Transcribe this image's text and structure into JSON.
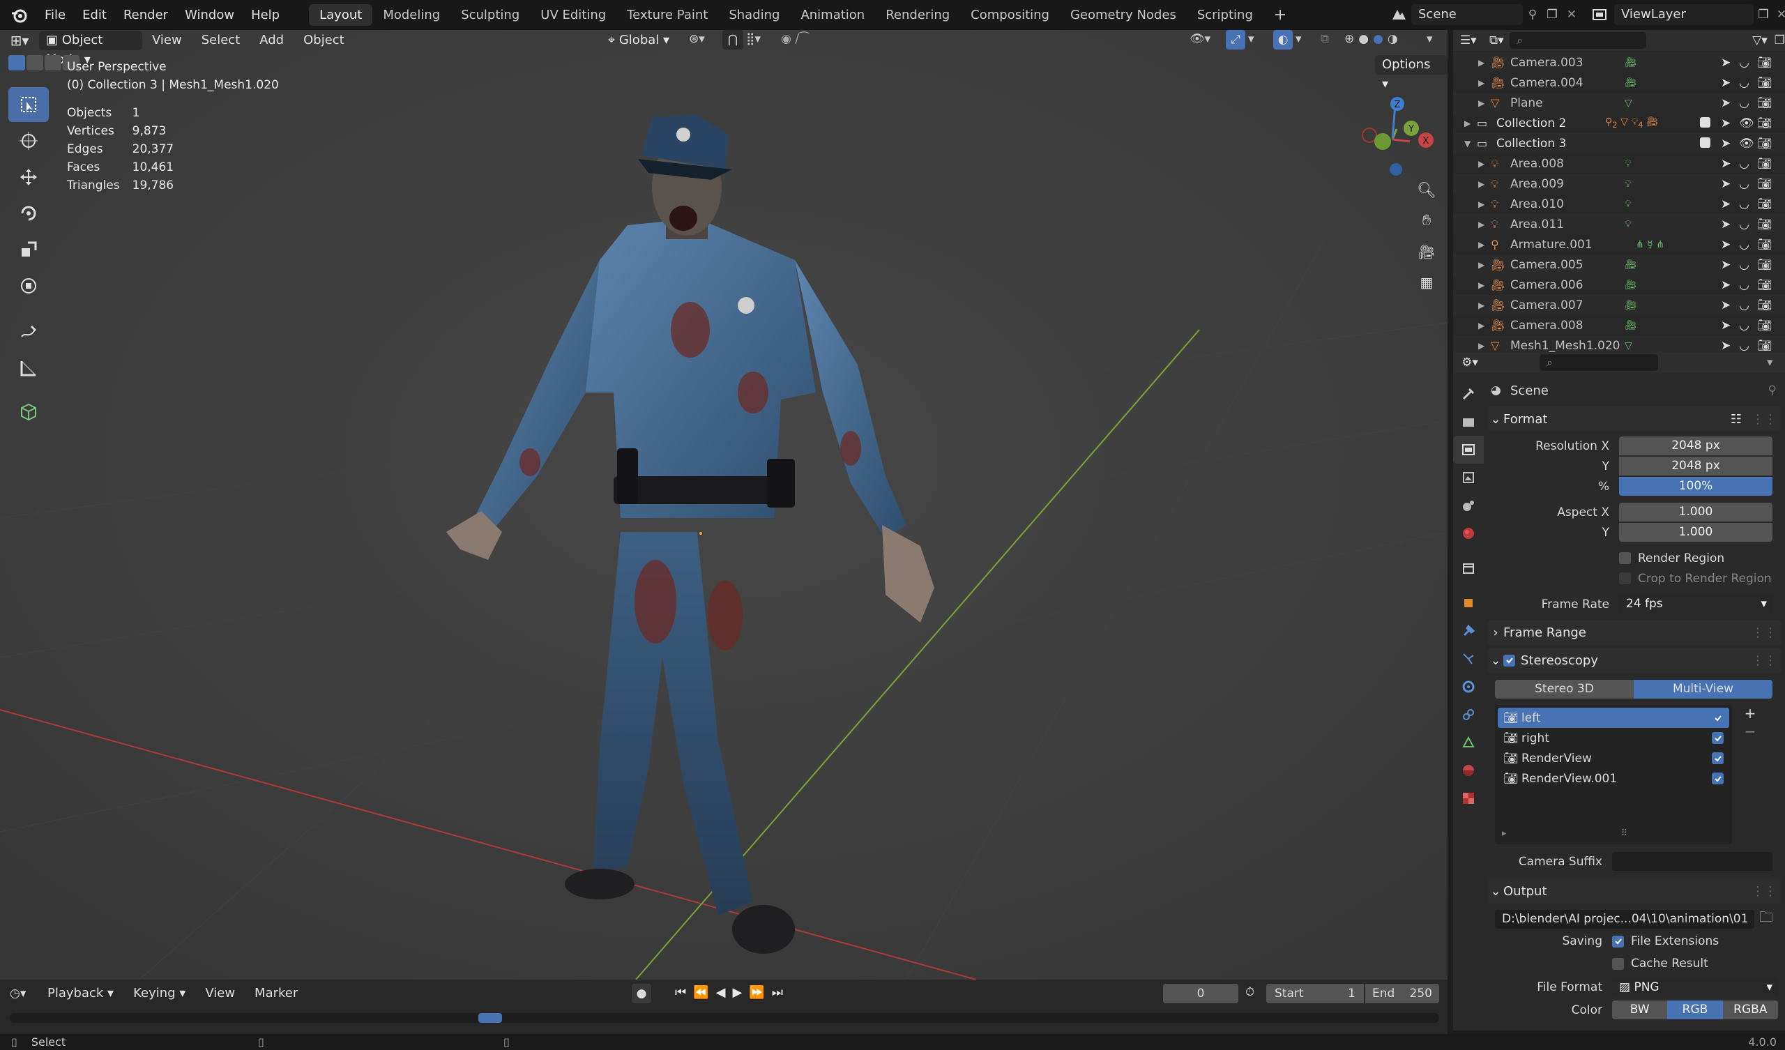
{
  "topbar": {
    "menus": [
      "File",
      "Edit",
      "Render",
      "Window",
      "Help"
    ],
    "workspaces": [
      "Layout",
      "Modeling",
      "Sculpting",
      "UV Editing",
      "Texture Paint",
      "Shading",
      "Animation",
      "Rendering",
      "Compositing",
      "Geometry Nodes",
      "Scripting"
    ],
    "active_workspace": "Layout",
    "add_tab": "+",
    "scene": "Scene",
    "view_layer": "ViewLayer"
  },
  "viewport": {
    "mode": "Object Mode",
    "menus": [
      "View",
      "Select",
      "Add",
      "Object"
    ],
    "transform_orientation": "Global",
    "options": "Options",
    "view_name": "User Perspective",
    "context": "(0) Collection 3 | Mesh1_Mesh1.020",
    "stats": [
      {
        "label": "Objects",
        "value": "1"
      },
      {
        "label": "Vertices",
        "value": "9,873"
      },
      {
        "label": "Edges",
        "value": "20,377"
      },
      {
        "label": "Faces",
        "value": "10,461"
      },
      {
        "label": "Triangles",
        "value": "19,786"
      }
    ],
    "gizmo": {
      "z": "Z",
      "y": "Y",
      "x": "X"
    }
  },
  "outliner": {
    "rows": [
      {
        "name": "Camera.003",
        "kind": "camera"
      },
      {
        "name": "Camera.004",
        "kind": "camera"
      },
      {
        "name": "Plane",
        "kind": "mesh"
      },
      {
        "name": "Collection 2",
        "kind": "collection"
      },
      {
        "name": "Collection 3",
        "kind": "collection"
      },
      {
        "name": "Area.008",
        "kind": "light"
      },
      {
        "name": "Area.009",
        "kind": "light"
      },
      {
        "name": "Area.010",
        "kind": "light"
      },
      {
        "name": "Area.011",
        "kind": "light"
      },
      {
        "name": "Armature.001",
        "kind": "armature"
      },
      {
        "name": "Camera.005",
        "kind": "camera"
      },
      {
        "name": "Camera.006",
        "kind": "camera"
      },
      {
        "name": "Camera.007",
        "kind": "camera"
      },
      {
        "name": "Camera.008",
        "kind": "camera"
      },
      {
        "name": "Mesh1_Mesh1.020",
        "kind": "mesh"
      }
    ],
    "collection2_badges": [
      "2",
      "4"
    ]
  },
  "properties": {
    "context": "Scene",
    "format": {
      "title": "Format",
      "resolution_x_label": "Resolution X",
      "resolution_x": "2048 px",
      "y_label": "Y",
      "resolution_y": "2048 px",
      "pct_label": "%",
      "resolution_pct": "100%",
      "aspect_x_label": "Aspect X",
      "aspect_x": "1.000",
      "aspect_y_label": "Y",
      "aspect_y": "1.000",
      "render_region": "Render Region",
      "crop_region": "Crop to Render Region",
      "frame_rate_label": "Frame Rate",
      "frame_rate": "24 fps"
    },
    "frame_range": "Frame Range",
    "stereoscopy": {
      "title": "Stereoscopy",
      "mode_a": "Stereo 3D",
      "mode_b": "Multi-View",
      "views": [
        "left",
        "right",
        "RenderView",
        "RenderView.001"
      ],
      "camera_suffix_label": "Camera Suffix",
      "camera_suffix": ""
    },
    "output": {
      "title": "Output",
      "path": "D:\\blender\\AI projec...04\\10\\animation\\01",
      "saving_label": "Saving",
      "file_extensions": "File Extensions",
      "cache_result": "Cache Result",
      "file_format_label": "File Format",
      "file_format": "PNG",
      "color_label": "Color",
      "color_modes": [
        "BW",
        "RGB",
        "RGBA"
      ],
      "active_color": "RGB"
    }
  },
  "timeline": {
    "menus": [
      "Playback",
      "Keying",
      "View",
      "Marker"
    ],
    "current_frame": "0",
    "start_label": "Start",
    "start": "1",
    "end_label": "End",
    "end": "250"
  },
  "statusbar": {
    "action": "Select",
    "version": "4.0.0"
  },
  "colors": {
    "accent": "#4772b3",
    "viewport_bg": "#3d3d3d",
    "x_axis": "#b03a3a",
    "y_axis": "#7aa33a"
  }
}
